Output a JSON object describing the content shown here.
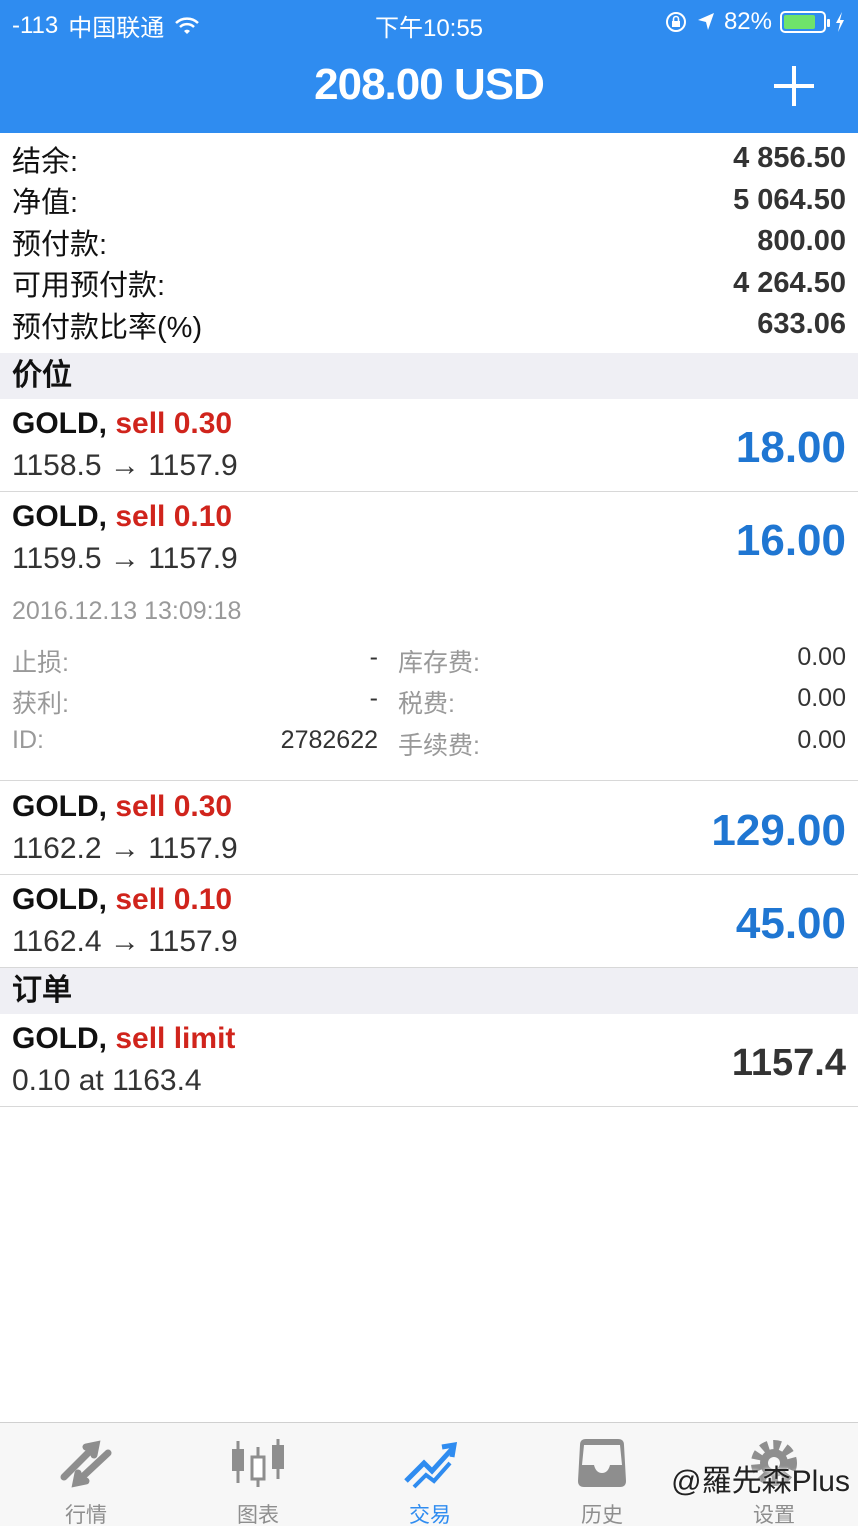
{
  "status": {
    "signal": "-113",
    "carrier": "中国联通",
    "time": "下午10:55",
    "battery": "82%"
  },
  "header": {
    "title": "208.00 USD"
  },
  "summary": [
    {
      "label": "结余:",
      "value": "4 856.50"
    },
    {
      "label": "净值:",
      "value": "5 064.50"
    },
    {
      "label": "预付款:",
      "value": "800.00"
    },
    {
      "label": "可用预付款:",
      "value": "4 264.50"
    },
    {
      "label": "预付款比率(%)",
      "value": "633.06"
    }
  ],
  "sections": {
    "positions": "价位",
    "orders": "订单"
  },
  "positions": [
    {
      "symbol": "GOLD,",
      "action": "sell 0.30",
      "prices": "1158.5 → 1157.9",
      "profit": "18.00"
    },
    {
      "symbol": "GOLD,",
      "action": "sell 0.10",
      "prices": "1159.5 → 1157.9",
      "profit": "16.00"
    },
    {
      "symbol": "GOLD,",
      "action": "sell 0.30",
      "prices": "1162.2 → 1157.9",
      "profit": "129.00"
    },
    {
      "symbol": "GOLD,",
      "action": "sell 0.10",
      "prices": "1162.4 → 1157.9",
      "profit": "45.00"
    }
  ],
  "detail": {
    "time": "2016.12.13 13:09:18",
    "sl_label": "止损:",
    "sl_value": "-",
    "tp_label": "获利:",
    "tp_value": "-",
    "id_label": "ID:",
    "id_value": "2782622",
    "swap_label": "库存费:",
    "swap_value": "0.00",
    "tax_label": "税费:",
    "tax_value": "0.00",
    "fee_label": "手续费:",
    "fee_value": "0.00"
  },
  "orders": [
    {
      "symbol": "GOLD,",
      "action": "sell limit",
      "info": "0.10 at 1163.4",
      "price": "1157.4"
    }
  ],
  "tabs": [
    {
      "label": "行情",
      "icon": "quotes-icon"
    },
    {
      "label": "图表",
      "icon": "chart-icon"
    },
    {
      "label": "交易",
      "icon": "trade-icon"
    },
    {
      "label": "历史",
      "icon": "history-icon"
    },
    {
      "label": "设置",
      "icon": "settings-icon"
    }
  ],
  "watermark": "@羅先森Plus",
  "colors": {
    "header": "#2f8cf0",
    "sell": "#d0241c",
    "profit": "#1f76d2"
  }
}
